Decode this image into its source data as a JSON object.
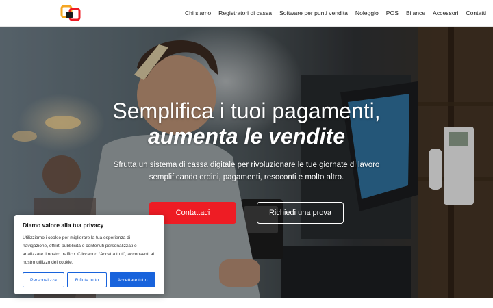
{
  "header": {
    "nav": [
      {
        "label": "Chi siamo"
      },
      {
        "label": "Registratori di cassa"
      },
      {
        "label": "Software per punti vendita"
      },
      {
        "label": "Noleggio"
      },
      {
        "label": "POS"
      },
      {
        "label": "Bilance"
      },
      {
        "label": "Accessori"
      },
      {
        "label": "Contatti"
      }
    ],
    "logo_icon": "logo-icon"
  },
  "hero": {
    "title_line1": "Semplifica i tuoi pagamenti,",
    "title_line2": "aumenta le vendite",
    "subtitle": "Sfrutta un sistema di cassa digitale per rivoluzionare le tue giornate di lavoro semplificando ordini, pagamenti, resoconti e molto altro.",
    "primary_button": "Contattaci",
    "secondary_button": "Richiedi una prova"
  },
  "cookie_banner": {
    "title": "Diamo valore alla tua privacy",
    "text": "Utilizziamo i cookie per migliorare la tua esperienza di navigazione, offrirti pubblicità o contenuti personalizzati e analizzare il nostro traffico. Cliccando “Accetta tutti”, acconsenti al nostro utilizzo dei cookie.",
    "customize_label": "Personalizza",
    "reject_label": "Rifiuta tutto",
    "accept_label": "Accettare tutto"
  },
  "colors": {
    "accent_red": "#ee1c24",
    "cookie_blue": "#1863dc"
  }
}
